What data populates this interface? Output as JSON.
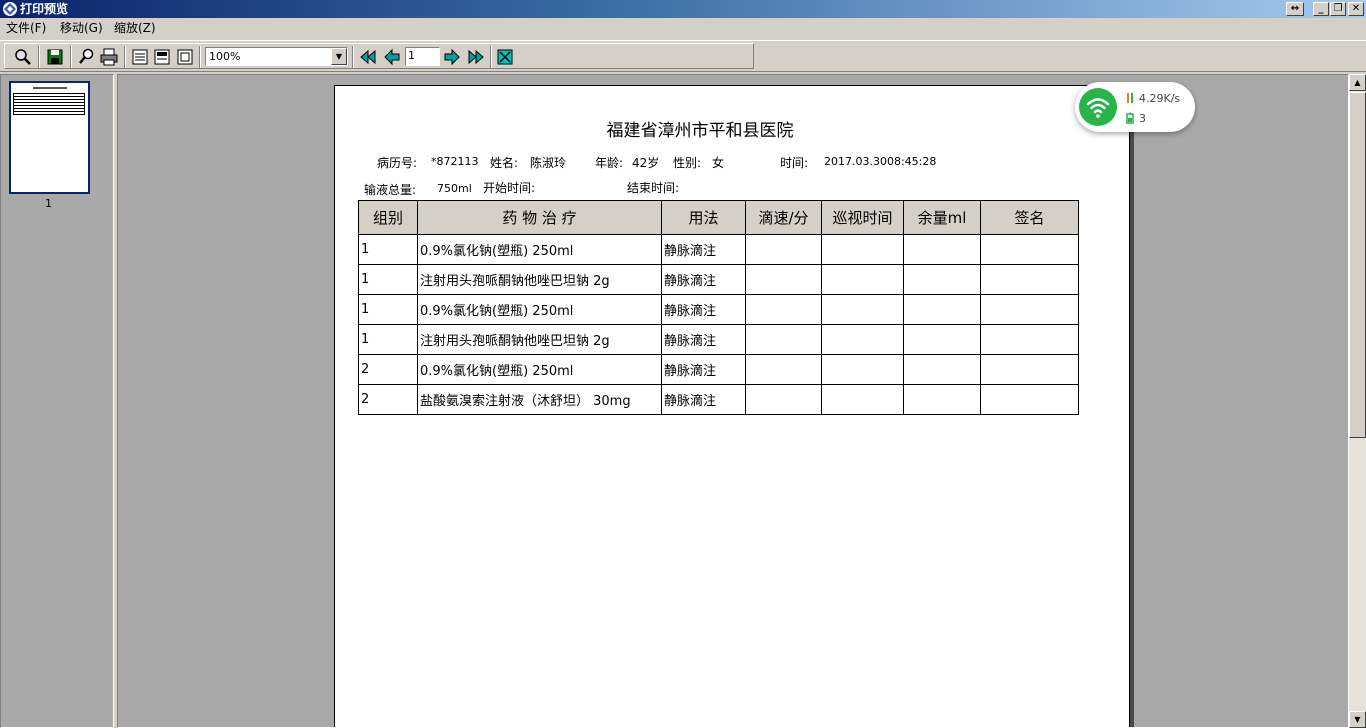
{
  "window": {
    "title": "打印预览"
  },
  "menu": [
    {
      "label": "文件(F)"
    },
    {
      "label": "移动(G)"
    },
    {
      "label": "缩放(Z)"
    }
  ],
  "toolbar": {
    "zoom": "100%",
    "page": "1"
  },
  "thumbnail": {
    "page_label": "1"
  },
  "document": {
    "title": "福建省漳州市平和县医院",
    "record_label": "病历号:",
    "record_value": "*872113",
    "name_label": "姓名:",
    "name_value": "陈淑玲",
    "age_label": "年龄:",
    "age_value": "42岁",
    "sex_label": "性别:",
    "sex_value": "女",
    "time_label": "时间:",
    "time_value": "2017.03.3008:45:28",
    "total_label": "输液总量:",
    "total_value": "750ml",
    "start_label": "开始时间:",
    "end_label": "结束时间:",
    "table": {
      "headers": [
        "组别",
        "药 物 治 疗",
        "用法",
        "滴速/分",
        "巡视时间",
        "余量ml",
        "签名"
      ],
      "rows": [
        [
          "1",
          "0.9%氯化钠(塑瓶) 250ml",
          "静脉滴注",
          "",
          "",
          "",
          ""
        ],
        [
          "1",
          "注射用头孢哌酮钠他唑巴坦钠 2g",
          "静脉滴注",
          "",
          "",
          "",
          ""
        ],
        [
          "1",
          "0.9%氯化钠(塑瓶) 250ml",
          "静脉滴注",
          "",
          "",
          "",
          ""
        ],
        [
          "1",
          "注射用头孢哌酮钠他唑巴坦钠 2g",
          "静脉滴注",
          "",
          "",
          "",
          ""
        ],
        [
          "2",
          "0.9%氯化钠(塑瓶) 250ml",
          "静脉滴注",
          "",
          "",
          "",
          ""
        ],
        [
          "2",
          "盐酸氨溴索注射液（沐舒坦） 30mg",
          "静脉滴注",
          "",
          "",
          "",
          ""
        ]
      ]
    }
  },
  "network_widget": {
    "speed": "4.29K/s",
    "count": "3"
  },
  "colors": {
    "titlebar_start": "#0a246a",
    "wifi_green": "#27b44a",
    "header_bg": "#d4d0c8"
  }
}
